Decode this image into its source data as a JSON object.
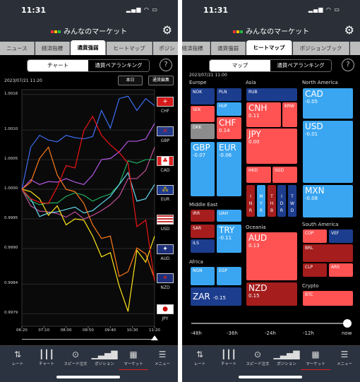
{
  "status": {
    "time": "11:31"
  },
  "app": {
    "title": "みんなのマーケット",
    "settings_icon": "gear-icon"
  },
  "left": {
    "tabs": [
      "ニュース",
      "経済指標",
      "通貨強弱",
      "ヒートマップ",
      "ポジシ"
    ],
    "active_tab": "通貨強弱",
    "segment": [
      "チャート",
      "通貨ペアランキング"
    ],
    "help": "?",
    "date": "2023/07/21 11:20",
    "today_button": "本日",
    "edit_button": "通貨編集",
    "flags": [
      {
        "code": "CHF",
        "icon": "swiss-flag-icon"
      },
      {
        "code": "GBP",
        "icon": "uk-flag-icon"
      },
      {
        "code": "CAD",
        "icon": "canada-flag-icon"
      },
      {
        "code": "EUR",
        "icon": "eu-flag-icon"
      },
      {
        "code": "USD",
        "icon": "us-flag-icon"
      },
      {
        "code": "AUD",
        "icon": "australia-flag-icon"
      },
      {
        "code": "NZD",
        "icon": "new-zealand-flag-icon"
      },
      {
        "code": "JPY",
        "icon": "japan-flag-icon"
      }
    ]
  },
  "chart_data": {
    "type": "line",
    "x": [
      "06:20",
      "06:40",
      "07:00",
      "07:20",
      "07:40",
      "08:00",
      "08:20",
      "08:40",
      "09:00",
      "09:20",
      "09:40",
      "10:00",
      "10:20",
      "10:40",
      "11:00",
      "11:20"
    ],
    "xticks": [
      "06:20",
      "07:10",
      "08:00",
      "08:50",
      "09:40",
      "10:30",
      "11:20"
    ],
    "yticks": [
      "1.0016",
      "1.0010",
      "1.0005",
      "1.0000",
      "0.9995",
      "0.9990",
      "0.9984",
      "0.9979"
    ],
    "ylim": [
      0.99769,
      1.00168
    ],
    "grid": true,
    "series": [
      {
        "color": "#3d6df2",
        "values": [
          1.0,
          1.00071,
          1.00091,
          1.00083,
          1.0008,
          1.00091,
          1.00087,
          1.00085,
          1.00089,
          1.00133,
          1.00103,
          1.00153,
          1.00157,
          1.00133,
          1.00153,
          1.00141
        ]
      },
      {
        "color": "#b357e3",
        "values": [
          1.0,
          1.00016,
          1.00008,
          1.00013,
          1.00012,
          1.00018,
          1.00012,
          1.00008,
          1.00024,
          1.0005,
          1.00052,
          1.00063,
          1.00081,
          1.00081,
          1.00085,
          1.00111
        ]
      },
      {
        "color": "#c4509c",
        "values": [
          1.0,
          0.99972,
          0.99963,
          0.99962,
          0.99959,
          0.99953,
          0.99962,
          0.9995,
          0.99956,
          0.99964,
          0.99974,
          0.99988,
          1.00018,
          1.00018,
          1.00032,
          1.00071
        ]
      },
      {
        "color": "#1fae5f",
        "values": [
          1.0,
          0.9998,
          0.99974,
          0.99977,
          0.99977,
          0.99988,
          0.99994,
          0.9999,
          0.9998,
          0.99987,
          0.99992,
          1.00008,
          1.00048,
          1.00044,
          1.0005,
          1.0005
        ]
      },
      {
        "color": "#62d6ee",
        "values": [
          1.0,
          0.99984,
          0.99954,
          0.9996,
          0.99962,
          0.99966,
          0.9997,
          0.9996,
          0.99964,
          0.99976,
          0.99988,
          1.00008,
          1.00028,
          0.9998,
          0.99984,
          1.00008
        ]
      },
      {
        "color": "#ff7a1a",
        "values": [
          1.0,
          1.00012,
          1.00052,
          1.00071,
          1.00024,
          1.0,
          0.99996,
          0.99976,
          0.9994,
          0.99917,
          0.99921,
          0.99853,
          0.99861,
          0.99901,
          0.99891,
          0.99849
        ]
      },
      {
        "color": "#ffe41a",
        "values": [
          1.0,
          0.99996,
          0.99984,
          0.99956,
          0.99972,
          0.9994,
          0.9995,
          0.99948,
          0.99921,
          0.99886,
          0.99893,
          0.99837,
          0.99794,
          0.99897,
          0.99877,
          0.99921
        ]
      },
      {
        "color": "#f01414",
        "values": [
          1.0,
          0.99984,
          0.99978,
          0.99976,
          1.00004,
          1.0004,
          1.00036,
          1.00099,
          1.00123,
          1.00091,
          1.00075,
          1.00062,
          1.00044,
          0.99937,
          0.99948,
          0.99845
        ]
      }
    ]
  },
  "right": {
    "tabs": [
      "経済指標",
      "通貨強弱",
      "ヒートマップ",
      "ポジションブック"
    ],
    "active_tab": "ヒートマップ",
    "segment": [
      "マップ",
      "通貨ペアランキング"
    ],
    "help": "?",
    "date": "2023/07/21 11:00",
    "regions": [
      "Europe",
      "Asia",
      "North America",
      "Middle East",
      "Oceania",
      "South America",
      "Africa",
      "Crypto"
    ],
    "colors": {
      "up_strong": "#a51d1d",
      "up": "#ff5252",
      "down": "#3aa6f2",
      "down_strong": "#1c3d8e",
      "flat": "#8c8c8c"
    },
    "tiles": [
      {
        "code": "NOK",
        "color": "#1c3d8e"
      },
      {
        "code": "PLN",
        "color": "#1c3d8e"
      },
      {
        "code": "SEK",
        "color": "#ff5252"
      },
      {
        "code": "HUF",
        "color": "#3aa6f2"
      },
      {
        "code": "CHF",
        "value": "0.14",
        "color": "#ff5252"
      },
      {
        "code": "DKK",
        "color": "#8c8c8c"
      },
      {
        "code": "GBP",
        "value": "-0.07",
        "color": "#3aa6f2"
      },
      {
        "code": "EUR",
        "value": "-0.06",
        "color": "#3aa6f2"
      },
      {
        "code": "RUB",
        "color": "#1c3d8e"
      },
      {
        "code": "CNH",
        "value": "0.11",
        "color": "#ff5252"
      },
      {
        "code": "KRW",
        "color": "#ff5252"
      },
      {
        "code": "JPY",
        "value": "0.00",
        "color": "#ff5252"
      },
      {
        "code": "HKD",
        "color": "#ff5252"
      },
      {
        "code": "SGD",
        "color": "#ff5252"
      },
      {
        "code": "INR",
        "color": "#a51d1d"
      },
      {
        "code": "MYR",
        "color": "#3aa6f2"
      },
      {
        "code": "THB",
        "color": "#a51d1d"
      },
      {
        "code": "IDR",
        "color": "#1c3d8e"
      },
      {
        "code": "TWD",
        "color": "#1c3d8e"
      },
      {
        "code": "CAD",
        "value": "-0.05",
        "color": "#3aa6f2"
      },
      {
        "code": "USD",
        "value": "-0.01",
        "color": "#3aa6f2"
      },
      {
        "code": "MXN",
        "value": "-0.08",
        "color": "#3aa6f2"
      },
      {
        "code": "IRR",
        "color": "#a51d1d"
      },
      {
        "code": "UAH",
        "color": "#3aa6f2"
      },
      {
        "code": "SAR",
        "color": "#a51d1d"
      },
      {
        "code": "TRY",
        "value": "-0.11",
        "color": "#3aa6f2"
      },
      {
        "code": "ILS",
        "color": "#1c3d8e"
      },
      {
        "code": "NGN",
        "color": "#3aa6f2"
      },
      {
        "code": "EGP",
        "color": "#3aa6f2"
      },
      {
        "code": "ZAR",
        "value": "-0.15",
        "color": "#1c3d8e"
      },
      {
        "code": "AUD",
        "value": "0.13",
        "color": "#ff5252"
      },
      {
        "code": "NZD",
        "value": "0.15",
        "color": "#a51d1d"
      },
      {
        "code": "COP",
        "color": "#ff5252"
      },
      {
        "code": "VEF",
        "color": "#1c3d8e"
      },
      {
        "code": "BRL",
        "color": "#a51d1d"
      },
      {
        "code": "CLP",
        "color": "#a51d1d"
      },
      {
        "code": "ARS",
        "color": "#ff5252"
      },
      {
        "code": "BTC",
        "color": "#ff5252"
      }
    ],
    "time_slider": {
      "labels": [
        "-48h",
        "-36h",
        "-24h",
        "-12h",
        "now"
      ],
      "value": "now"
    }
  },
  "nav": [
    {
      "label": "レート",
      "icon": "rate-arrows-icon"
    },
    {
      "label": "チャート",
      "icon": "candlestick-icon"
    },
    {
      "label": "スピード注文",
      "icon": "speed-order-icon"
    },
    {
      "label": "ポジション",
      "icon": "bar-chart-icon"
    },
    {
      "label": "マーケット",
      "icon": "market-newspaper-icon",
      "active": true
    },
    {
      "label": "メニュー",
      "icon": "menu-icon"
    }
  ]
}
